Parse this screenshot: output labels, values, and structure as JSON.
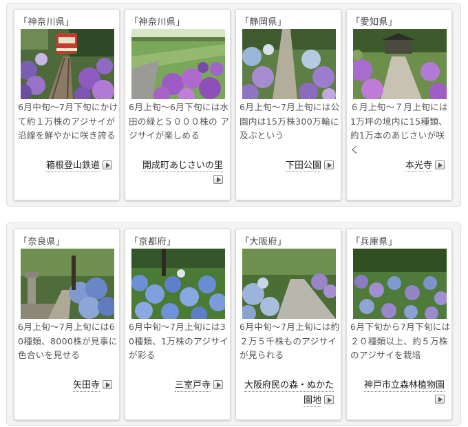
{
  "rows": [
    {
      "cards": [
        {
          "prefecture": "「神奈川県」",
          "description": "6月中旬～7月下旬にかけて約１万株のアジサイが沿線を鮮やかに咲き誇る",
          "link": "箱根登山鉄道",
          "photo": "train-hydrangea-photo"
        },
        {
          "prefecture": "「神奈川県」",
          "description": "6月上旬～6月下旬には水田の緑と５０００株の アジサイが楽しめる",
          "link": "開成町あじさいの里",
          "photo": "rice-field-hydrangea-photo"
        },
        {
          "prefecture": "「静岡県」",
          "description": "6月上旬～7月上旬には公園内は15万株300万輪に及ぶという",
          "link": "下田公園",
          "photo": "park-path-hydrangea-photo"
        },
        {
          "prefecture": "「愛知県」",
          "description": "６月上旬～７月上旬には1万坪の境内に15種類、約1万本のあじさいが咲く",
          "link": "本光寺",
          "photo": "temple-path-hydrangea-photo"
        }
      ]
    },
    {
      "cards": [
        {
          "prefecture": "「奈良県」",
          "description": "6月上旬～7月上旬には60種類、8000株が見事に色合いを見せる",
          "link": "矢田寺",
          "photo": "stone-lantern-hydrangea-photo"
        },
        {
          "prefecture": "「京都府」",
          "description": "6月中旬～7月上旬には30種類、1万株のアジサイが彩る",
          "link": "三室戸寺",
          "photo": "blue-hydrangea-garden-photo"
        },
        {
          "prefecture": "「大阪府」",
          "description": "6月中旬～7月上旬には約２万５千株ものアジサイが見られる",
          "link": "大阪府民の森・ぬかた園地",
          "photo": "forest-road-hydrangea-photo"
        },
        {
          "prefecture": "「兵庫県」",
          "description": "6月下旬から7月下旬には２０種類以上、約５万株のアジサイを栽培",
          "link": "神戸市立森林植物園",
          "photo": "hillside-hydrangea-photo"
        }
      ]
    }
  ],
  "icons": {
    "link_arrow": "play-arrow-icon"
  }
}
